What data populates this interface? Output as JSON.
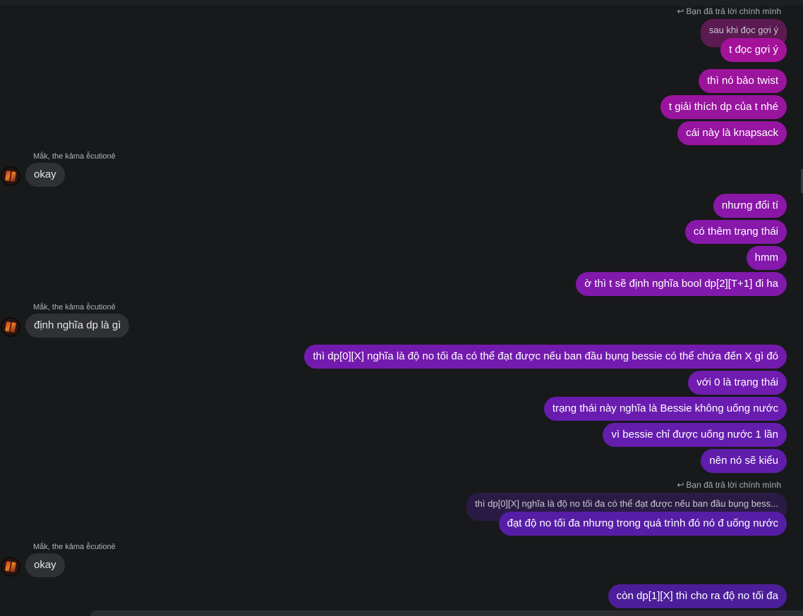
{
  "reply_notes": {
    "first": "Bạn đã trả lời chính mình",
    "second": "Bạn đã trả lời chính mình"
  },
  "quoted": {
    "first": "sau khi đọc gợi ý",
    "second": "thì dp[0][X] nghĩa là độ no tối đa có thể đạt được nếu ban đầu bụng bess..."
  },
  "sender_name": "Mắk, the kảma ễcutionẻ",
  "outgoing": {
    "m1": "t đọc gợi ý",
    "m2": "thì nó bảo twist",
    "m3": "t giải thích dp của t nhé",
    "m4": "cái này là knapsack",
    "m5": "nhưng đổi tí",
    "m6": "có thêm trạng thái",
    "m7": "hmm",
    "m8": "ờ thì t sẽ định nghĩa bool dp[2][T+1] đi ha",
    "m9": "thì dp[0][X] nghĩa là độ no tối đa có thể đạt được nếu ban đầu bụng bessie có thể chứa đến X gì đó",
    "m10": "với 0 là trạng thái",
    "m11": "trạng thái này nghĩa là Bessie không uống nước",
    "m12": "vì bessie chỉ được uống nước 1 lần",
    "m13": "nên nó sẽ kiểu",
    "m14": "đạt độ no tối đa nhưng trong quá trình đó nó đ uống nước",
    "m15": "còn dp[1][X] thì cho ra độ no tối đa"
  },
  "incoming": {
    "i1": "okay",
    "i2": "định nghĩa dp là gì",
    "i3": "okay"
  },
  "colors": {
    "background": "#18191b",
    "incoming_bubble": "#303134",
    "gradient_top": "#a4129a",
    "gradient_bottom": "#4c1e99"
  }
}
